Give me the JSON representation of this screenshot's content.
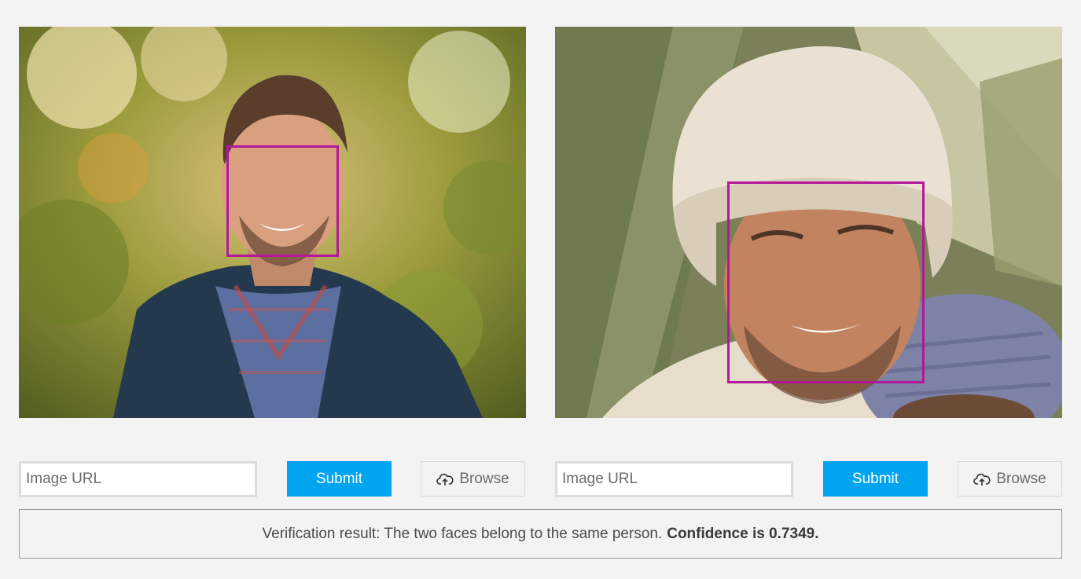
{
  "colors": {
    "page_background": "#f3f3f3",
    "face_box": "#b3179a",
    "submit_button": "#00a4ef",
    "input_border": "#dcdcdc",
    "result_border": "#9a9a9a"
  },
  "left_panel": {
    "image_icon": "photo-of-smiling-man-in-jacket",
    "url_input": {
      "placeholder": "Image URL",
      "value": ""
    },
    "submit_label": "Submit",
    "browse_label": "Browse",
    "browse_icon": "cloud-upload-icon"
  },
  "right_panel": {
    "image_icon": "photo-of-smiling-man-in-beanie",
    "url_input": {
      "placeholder": "Image URL",
      "value": ""
    },
    "submit_label": "Submit",
    "browse_label": "Browse",
    "browse_icon": "cloud-upload-icon"
  },
  "result": {
    "text": "Verification result: The two faces belong to the same person.",
    "confidence": "Confidence is 0.7349."
  }
}
